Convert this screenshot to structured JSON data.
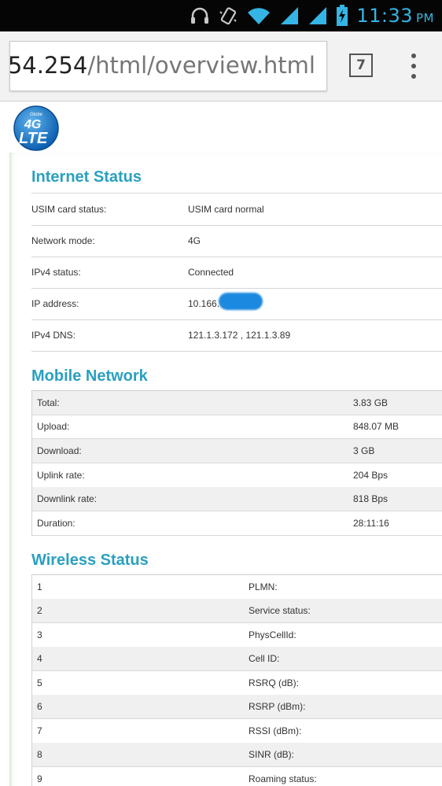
{
  "status_bar": {
    "time": "11:33",
    "ampm": "PM",
    "icons": [
      "headphones-icon",
      "vibrate-icon",
      "wifi-icon",
      "signal-icon",
      "signal-icon",
      "battery-charging-icon"
    ]
  },
  "browser": {
    "url_host": "·54.254",
    "url_path": "/html/overview.html",
    "tab_count": "7"
  },
  "logo": {
    "brand": "Globe",
    "line1": "4G",
    "line2": "LTE"
  },
  "internet_status": {
    "title": "Internet Status",
    "rows": [
      {
        "label": "USIM card status:",
        "value": "USIM card normal"
      },
      {
        "label": "Network mode:",
        "value": "4G"
      },
      {
        "label": "IPv4 status:",
        "value": "Connected"
      },
      {
        "label": "IP address:",
        "value": "10.166."
      },
      {
        "label": "IPv4 DNS:",
        "value": "121.1.3.172 , 121.1.3.89"
      }
    ]
  },
  "mobile_network": {
    "title": "Mobile Network",
    "rows": [
      {
        "label": "Total:",
        "value": "3.83 GB"
      },
      {
        "label": "Upload:",
        "value": "848.07 MB"
      },
      {
        "label": "Download:",
        "value": "3 GB"
      },
      {
        "label": "Uplink rate:",
        "value": "204 Bps"
      },
      {
        "label": "Downlink rate:",
        "value": "818 Bps"
      },
      {
        "label": "Duration:",
        "value": "28:11:16"
      }
    ]
  },
  "wireless_status": {
    "title": "Wireless Status",
    "rows": [
      {
        "index": "1",
        "label": "PLMN:"
      },
      {
        "index": "2",
        "label": "Service status:"
      },
      {
        "index": "3",
        "label": "PhysCellId:"
      },
      {
        "index": "4",
        "label": "Cell ID:"
      },
      {
        "index": "5",
        "label": "RSRQ (dB):"
      },
      {
        "index": "6",
        "label": "RSRP (dBm):"
      },
      {
        "index": "7",
        "label": "RSSI (dBm):"
      },
      {
        "index": "8",
        "label": "SINR (dB):"
      },
      {
        "index": "9",
        "label": "Roaming status:"
      }
    ]
  },
  "colors": {
    "accent": "#2aa0c0",
    "status_icon": "#35b5e5"
  }
}
